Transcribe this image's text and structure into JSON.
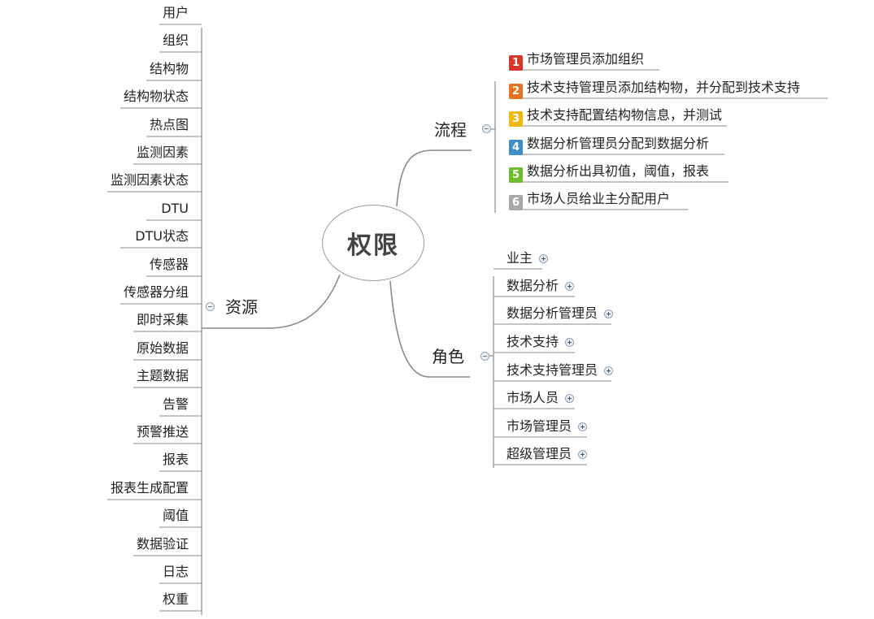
{
  "center": {
    "label": "权限"
  },
  "branches": {
    "flow": {
      "label": "流程"
    },
    "role": {
      "label": "角色"
    },
    "resource": {
      "label": "资源"
    }
  },
  "flow_steps": [
    {
      "num": "1",
      "color": "#d9352a",
      "label": "市场管理员添加组织"
    },
    {
      "num": "2",
      "color": "#e8731c",
      "label": "技术支持管理员添加结构物，并分配到技术支持"
    },
    {
      "num": "3",
      "color": "#f2b807",
      "label": "技术支持配置结构物信息，并测试"
    },
    {
      "num": "4",
      "color": "#3a8fc9",
      "label": "数据分析管理员分配到数据分析"
    },
    {
      "num": "5",
      "color": "#6dbf2a",
      "label": "数据分析出具初值，阈值，报表"
    },
    {
      "num": "6",
      "color": "#a8a8a8",
      "label": "市场人员给业主分配用户"
    }
  ],
  "roles": [
    "业主",
    "数据分析",
    "数据分析管理员",
    "技术支持",
    "技术支持管理员",
    "市场人员",
    "市场管理员",
    "超级管理员"
  ],
  "resources": [
    "用户",
    "组织",
    "结构物",
    "结构物状态",
    "热点图",
    "监测因素",
    "监测因素状态",
    "DTU",
    "DTU状态",
    "传感器",
    "传感器分组",
    "即时采集",
    "原始数据",
    "主题数据",
    "告警",
    "预警推送",
    "报表",
    "报表生成配置",
    "阈值",
    "数据验证",
    "日志",
    "权重"
  ],
  "icons": {
    "collapse": "collapse-minus-icon",
    "expand": "expand-plus-icon"
  }
}
